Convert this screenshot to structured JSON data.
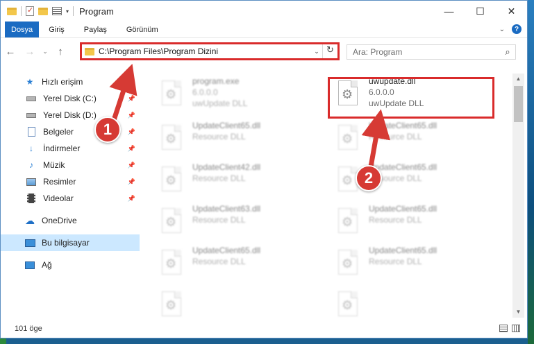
{
  "window": {
    "title": "Program",
    "controls": {
      "minimize": "—",
      "maximize": "☐",
      "close": "✕"
    }
  },
  "ribbon": {
    "tabs": [
      {
        "label": "Dosya",
        "active": true
      },
      {
        "label": "Giriş"
      },
      {
        "label": "Paylaş"
      },
      {
        "label": "Görünüm"
      }
    ],
    "help": "?"
  },
  "nav": {
    "address": "C:\\Program Files\\Program Dizini",
    "search_placeholder": "Ara: Program"
  },
  "sidebar": {
    "items": [
      {
        "label": "Hızlı erişim",
        "icon": "star-icon",
        "pinned": false
      },
      {
        "label": "Yerel Disk (C:)",
        "icon": "drive-icon",
        "pinned": true
      },
      {
        "label": "Yerel Disk (D:)",
        "icon": "drive-icon",
        "pinned": true
      },
      {
        "label": "Belgeler",
        "icon": "documents-icon",
        "pinned": true
      },
      {
        "label": "İndirmeler",
        "icon": "download-icon",
        "pinned": true
      },
      {
        "label": "Müzik",
        "icon": "music-icon",
        "pinned": true
      },
      {
        "label": "Resimler",
        "icon": "pictures-icon",
        "pinned": true
      },
      {
        "label": "Videolar",
        "icon": "video-icon",
        "pinned": true
      },
      {
        "label": "OneDrive",
        "icon": "cloud-icon"
      },
      {
        "label": "Bu bilgisayar",
        "icon": "computer-icon",
        "selected": true
      },
      {
        "label": "Ağ",
        "icon": "network-icon"
      }
    ]
  },
  "files": {
    "highlighted": {
      "name": "uwupdate.dll",
      "version": "6.0.0.0",
      "description": "uwUpdate DLL"
    },
    "others": [
      {
        "name": "program.exe",
        "line2": "6.0.0.0",
        "line3": "uwUpdate DLL"
      },
      {
        "name": "UpdateClient65.dll",
        "line2": "Resource DLL"
      },
      {
        "name": "UpdateClient65.dll",
        "line2": "Resource DLL"
      },
      {
        "name": "UpdateClient42.dll",
        "line2": "Resource DLL"
      },
      {
        "name": "UpdateClient65.dll",
        "line2": "Resource DLL"
      },
      {
        "name": "UpdateClient63.dll",
        "line2": "Resource DLL"
      },
      {
        "name": "UpdateClient65.dll",
        "line2": "Resource DLL"
      },
      {
        "name": "UpdateClient65.dll",
        "line2": "Resource DLL"
      },
      {
        "name": "UpdateClient65.dll",
        "line2": "Resource DLL"
      }
    ]
  },
  "annotations": {
    "step1": "1",
    "step2": "2",
    "color": "#d63a34"
  },
  "status": {
    "item_count": "101 öge"
  }
}
